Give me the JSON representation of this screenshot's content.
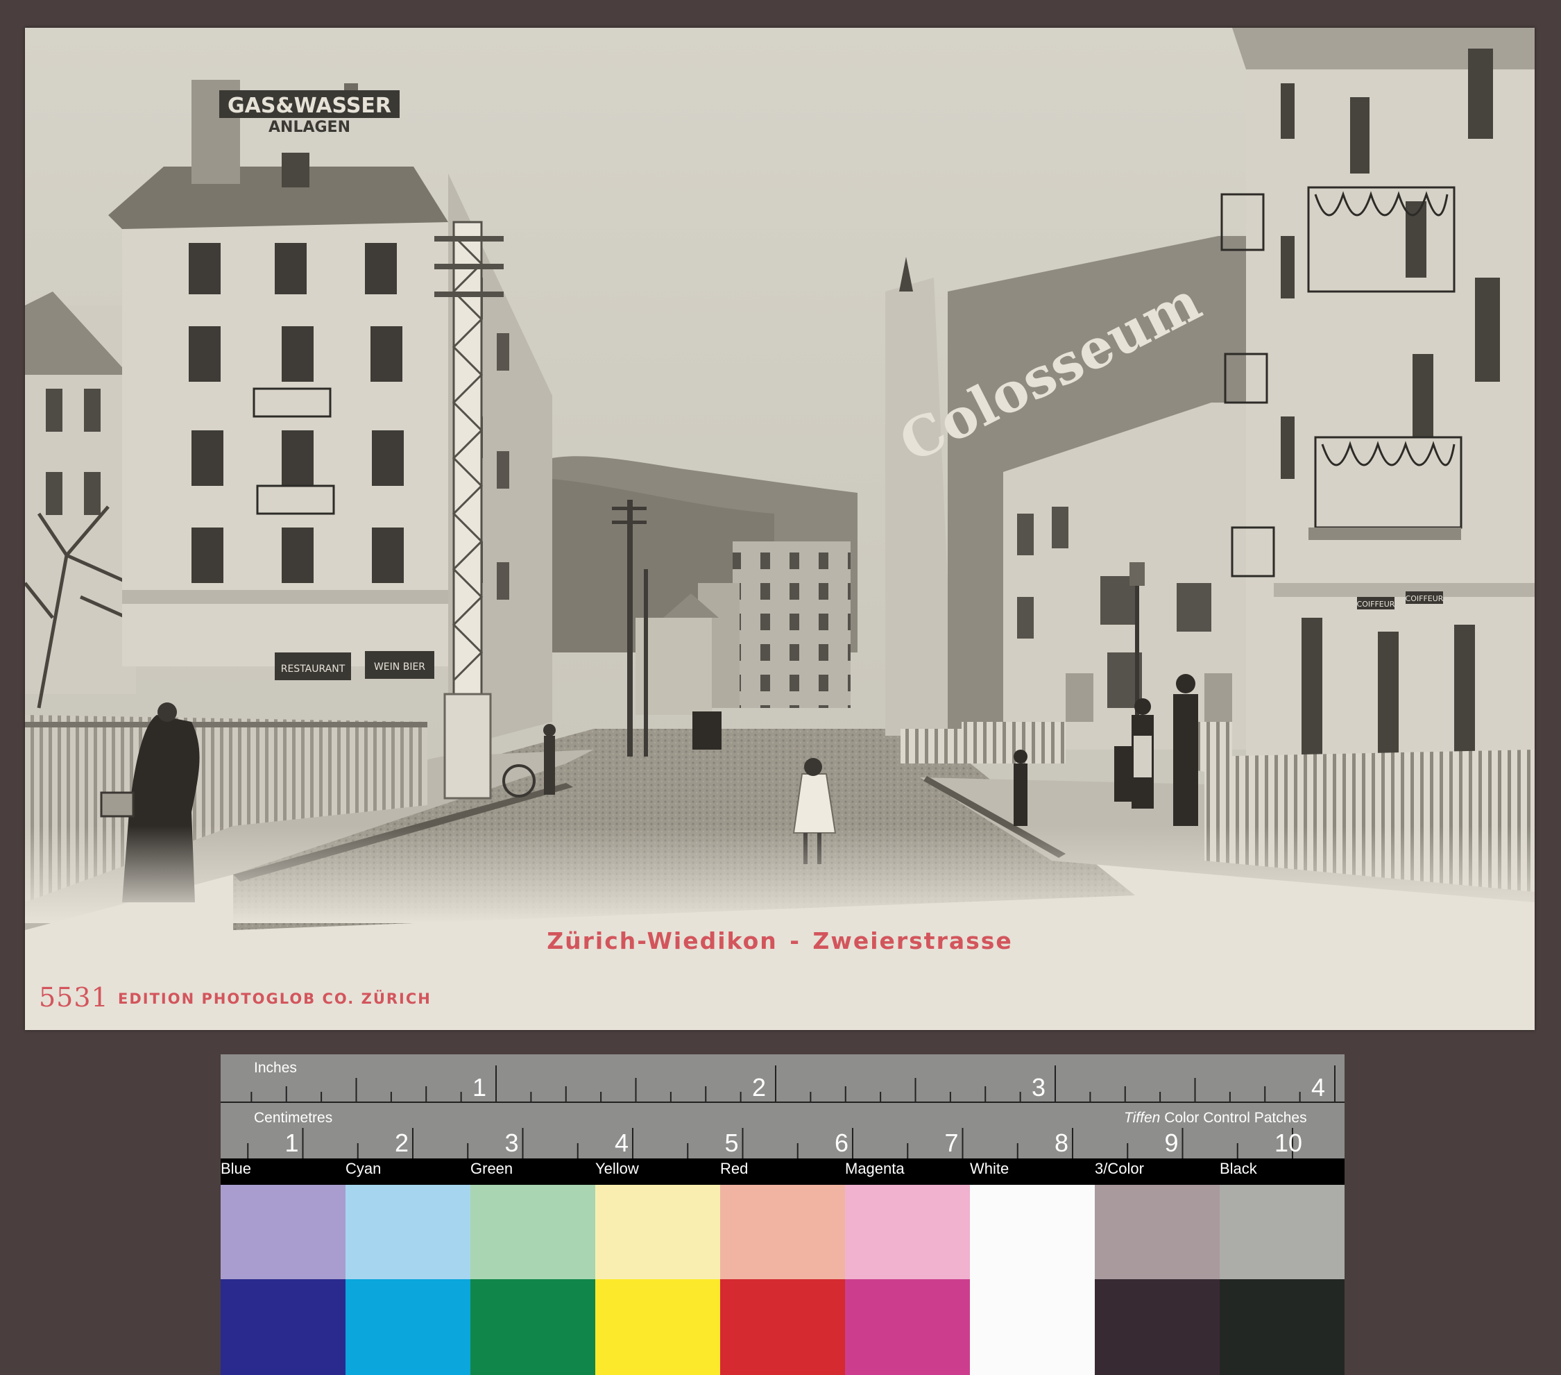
{
  "photo": {
    "sign_gas": "GAS&WASSER",
    "sign_anlagen": "ANLAGEN",
    "sign_colosseum": "Colosseum",
    "sign_restaurant": "RESTAURANT",
    "sign_wein_bier": "WEIN BIER",
    "sign_coiffeur": "COIFFEUR"
  },
  "caption": "Zürich-Wiedikon - Zweierstrasse",
  "edition_number": "5531",
  "edition_text": "EDITION PHOTOGLOB CO. ZÜRICH",
  "ruler": {
    "inches_label": "Inches",
    "centimetres_label": "Centimetres",
    "inch_numbers": [
      "1",
      "2",
      "3",
      "4"
    ],
    "cm_numbers": [
      "1",
      "2",
      "3",
      "4",
      "5",
      "6",
      "7",
      "8",
      "9",
      "10"
    ],
    "tiffen_brand": "Tiffen",
    "tiffen_rest": "Color Control Patches"
  },
  "color_patches": [
    {
      "label": "Blue",
      "top": "#a99dd0",
      "bottom": "#2a2a8e"
    },
    {
      "label": "Cyan",
      "top": "#a6d6ef",
      "bottom": "#0aa6dc"
    },
    {
      "label": "Green",
      "top": "#a9d5b2",
      "bottom": "#11864a"
    },
    {
      "label": "Yellow",
      "top": "#f9eeb0",
      "bottom": "#fde92c"
    },
    {
      "label": "Red",
      "top": "#f1b4a2",
      "bottom": "#d42a30"
    },
    {
      "label": "Magenta",
      "top": "#f0b2cf",
      "bottom": "#cc3e8d"
    },
    {
      "label": "White",
      "top": "#fbfbfb",
      "bottom": "#fbfbfb"
    },
    {
      "label": "3/Color",
      "top": "#a99a9d",
      "bottom": "#382a33"
    },
    {
      "label": "Black",
      "top": "#acaca8",
      "bottom": "#232724"
    }
  ]
}
